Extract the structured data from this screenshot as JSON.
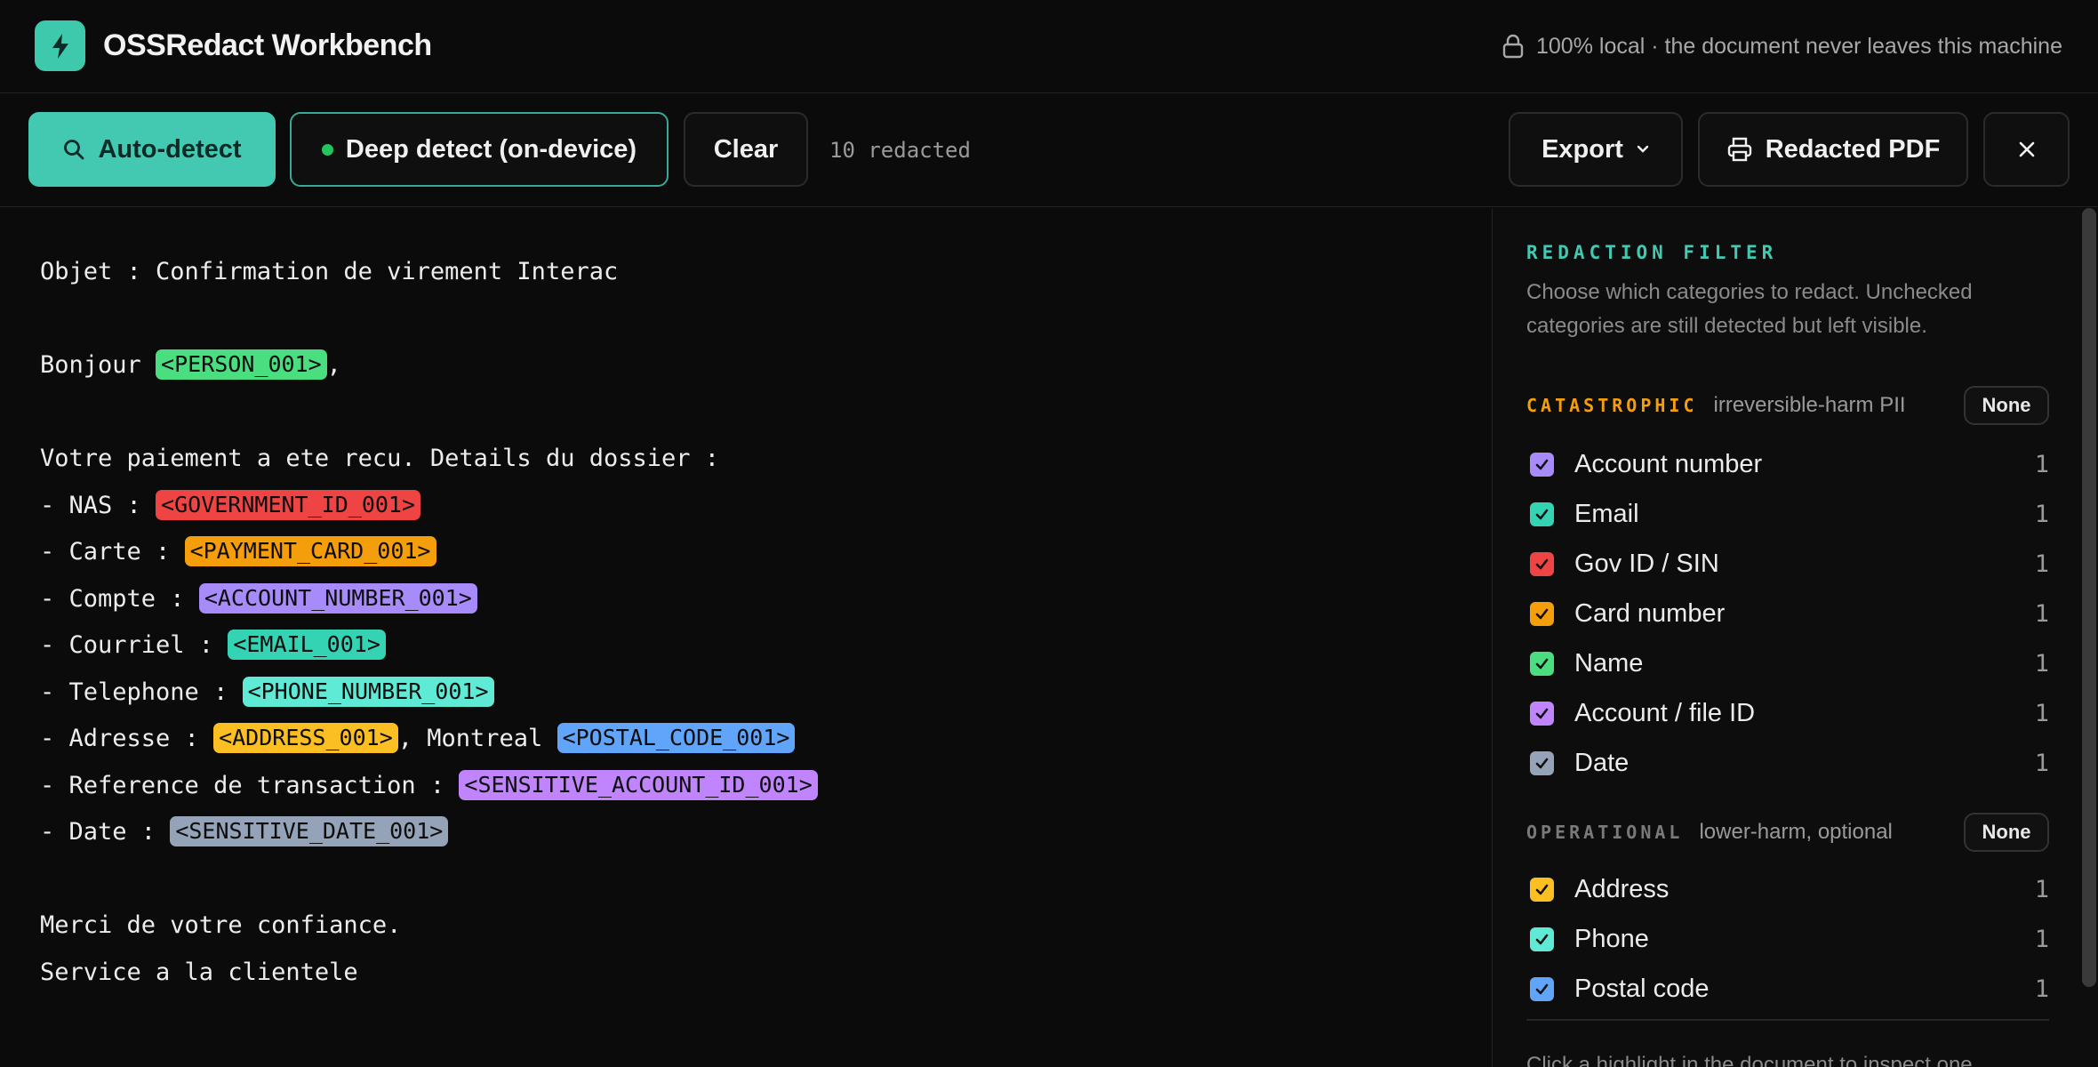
{
  "app": {
    "title": "OSSRedact Workbench",
    "privacy_note": "100% local · the document never leaves this machine"
  },
  "toolbar": {
    "auto_detect": "Auto-detect",
    "deep_detect": "Deep detect (on-device)",
    "clear": "Clear",
    "redacted_count": "10 redacted",
    "export": "Export",
    "redacted_pdf": "Redacted PDF"
  },
  "document": {
    "l1": "Objet : Confirmation de virement Interac",
    "l2_pre": "Bonjour ",
    "l2_tag": "<PERSON_001>",
    "l2_post": ",",
    "l3": "Votre paiement a ete recu. Details du dossier :",
    "l4_pre": "- NAS : ",
    "l4_tag": "<GOVERNMENT_ID_001>",
    "l5_pre": "- Carte : ",
    "l5_tag": "<PAYMENT_CARD_001>",
    "l6_pre": "- Compte : ",
    "l6_tag": "<ACCOUNT_NUMBER_001>",
    "l7_pre": "- Courriel : ",
    "l7_tag": "<EMAIL_001>",
    "l8_pre": "- Telephone : ",
    "l8_tag": "<PHONE_NUMBER_001>",
    "l9_pre": "- Adresse : ",
    "l9_tag": "<ADDRESS_001>",
    "l9_mid": ", Montreal ",
    "l9_tag2": "<POSTAL_CODE_001>",
    "l10_pre": "- Reference de transaction : ",
    "l10_tag": "<SENSITIVE_ACCOUNT_ID_001>",
    "l11_pre": "- Date : ",
    "l11_tag": "<SENSITIVE_DATE_001>",
    "l12": "Merci de votre confiance.",
    "l13": "Service a la clientele"
  },
  "colors": {
    "person": "#4ade80",
    "gov": "#ef4444",
    "card": "#f59e0b",
    "account": "#a78bfa",
    "email": "#34d3b4",
    "phone": "#5eead4",
    "address": "#fbbf24",
    "postal": "#60a5fa",
    "file_id": "#c084fc",
    "date": "#94a3b8",
    "accent": "#43c9b2"
  },
  "filter": {
    "title": "REDACTION FILTER",
    "description": "Choose which categories to redact. Unchecked categories are still detected but left visible.",
    "catastrophic": {
      "label": "CATASTROPHIC",
      "sub": "irreversible-harm PII",
      "none": "None"
    },
    "operational": {
      "label": "OPERATIONAL",
      "sub": "lower-harm, optional",
      "none": "None"
    },
    "cat_items": [
      {
        "label": "Account number",
        "count": "1",
        "color": "#a78bfa"
      },
      {
        "label": "Email",
        "count": "1",
        "color": "#34d3b4"
      },
      {
        "label": "Gov ID / SIN",
        "count": "1",
        "color": "#ef4444"
      },
      {
        "label": "Card number",
        "count": "1",
        "color": "#f59e0b"
      },
      {
        "label": "Name",
        "count": "1",
        "color": "#4ade80"
      },
      {
        "label": "Account / file ID",
        "count": "1",
        "color": "#c084fc"
      },
      {
        "label": "Date",
        "count": "1",
        "color": "#94a3b8"
      }
    ],
    "op_items": [
      {
        "label": "Address",
        "count": "1",
        "color": "#fbbf24"
      },
      {
        "label": "Phone",
        "count": "1",
        "color": "#5eead4"
      },
      {
        "label": "Postal code",
        "count": "1",
        "color": "#60a5fa"
      }
    ],
    "hint": "Click a highlight in the document to inspect one"
  }
}
